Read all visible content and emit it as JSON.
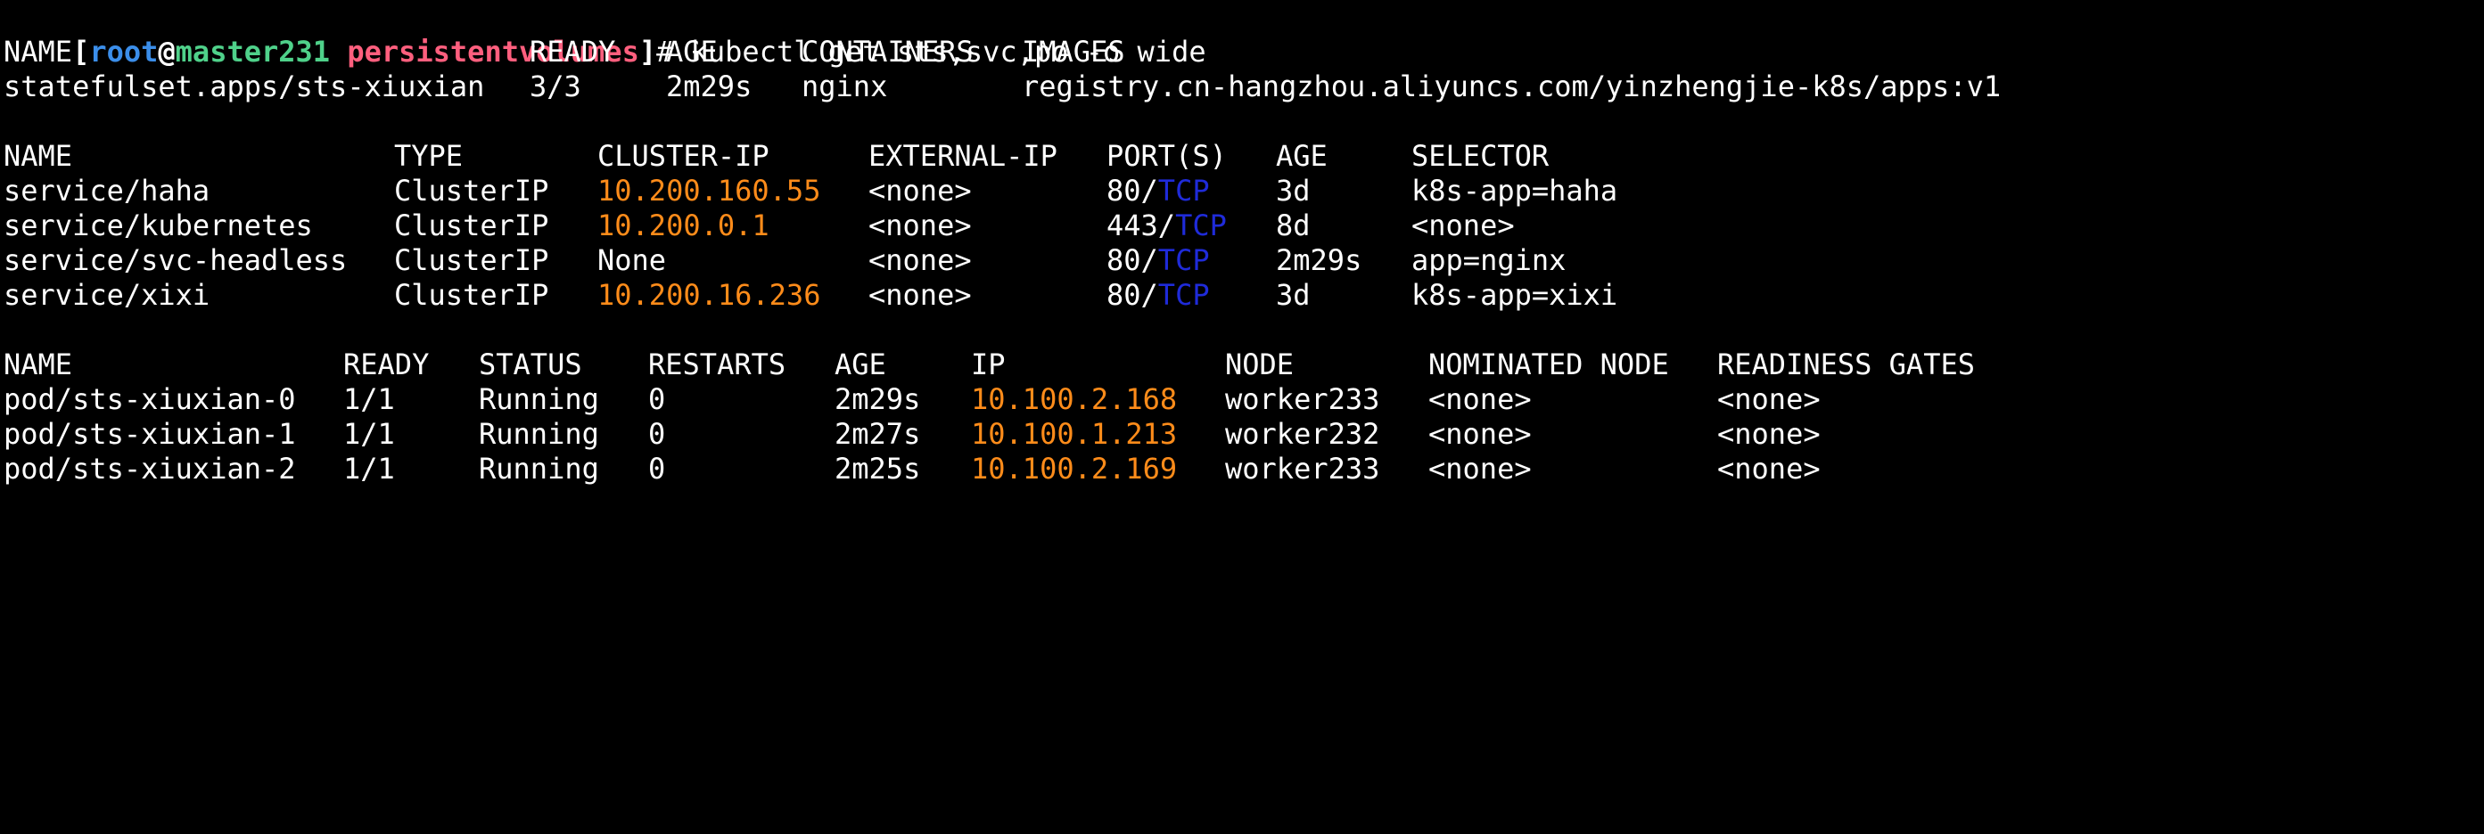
{
  "prompt": {
    "open_bracket": "[",
    "user": "root",
    "at": "@",
    "host": "master231",
    "cwd": "persistentvolumes",
    "close_bracket": "]",
    "symbol": "# ",
    "command": "kubectl get sts,svc,po -o wide"
  },
  "statefulsets": {
    "headers": [
      "NAME",
      "READY",
      "AGE",
      "CONTAINERS",
      "IMAGES"
    ],
    "rows": [
      [
        "statefulset.apps/sts-xiuxian",
        "3/3",
        "2m29s",
        "nginx",
        "registry.cn-hangzhou.aliyuncs.com/yinzhengjie-k8s/apps:v1"
      ]
    ]
  },
  "services": {
    "headers": [
      "NAME",
      "TYPE",
      "CLUSTER-IP",
      "EXTERNAL-IP",
      "PORT(S)",
      "AGE",
      "SELECTOR"
    ],
    "rows": [
      {
        "name": "service/haha",
        "type": "ClusterIP",
        "cluster_ip": "10.200.160.55",
        "ip_colored": true,
        "external_ip": "<none>",
        "port": "80/",
        "proto": "TCP",
        "age": "3d",
        "selector": "k8s-app=haha"
      },
      {
        "name": "service/kubernetes",
        "type": "ClusterIP",
        "cluster_ip": "10.200.0.1",
        "ip_colored": true,
        "external_ip": "<none>",
        "port": "443/",
        "proto": "TCP",
        "age": "8d",
        "selector": "<none>"
      },
      {
        "name": "service/svc-headless",
        "type": "ClusterIP",
        "cluster_ip": "None",
        "ip_colored": false,
        "external_ip": "<none>",
        "port": "80/",
        "proto": "TCP",
        "age": "2m29s",
        "selector": "app=nginx"
      },
      {
        "name": "service/xixi",
        "type": "ClusterIP",
        "cluster_ip": "10.200.16.236",
        "ip_colored": true,
        "external_ip": "<none>",
        "port": "80/",
        "proto": "TCP",
        "age": "3d",
        "selector": "k8s-app=xixi"
      }
    ]
  },
  "pods": {
    "headers": [
      "NAME",
      "READY",
      "STATUS",
      "RESTARTS",
      "AGE",
      "IP",
      "NODE",
      "NOMINATED NODE",
      "READINESS GATES"
    ],
    "rows": [
      {
        "name": "pod/sts-xiuxian-0",
        "ready": "1/1",
        "status": "Running",
        "restarts": "0",
        "age": "2m29s",
        "ip": "10.100.2.168",
        "node": "worker233",
        "nominated": "<none>",
        "gates": "<none>"
      },
      {
        "name": "pod/sts-xiuxian-1",
        "ready": "1/1",
        "status": "Running",
        "restarts": "0",
        "age": "2m27s",
        "ip": "10.100.1.213",
        "node": "worker232",
        "nominated": "<none>",
        "gates": "<none>"
      },
      {
        "name": "pod/sts-xiuxian-2",
        "ready": "1/1",
        "status": "Running",
        "restarts": "0",
        "age": "2m25s",
        "ip": "10.100.2.169",
        "node": "worker233",
        "nominated": "<none>",
        "gates": "<none>"
      }
    ]
  },
  "colors": {
    "background": "#000000",
    "text": "#ffffff",
    "prompt_user": "#3b8eea",
    "prompt_host": "#4fd18a",
    "prompt_cwd": "#ff5f7e",
    "ip_address": "#ff8c1a",
    "protocol": "#1f2bd9"
  }
}
